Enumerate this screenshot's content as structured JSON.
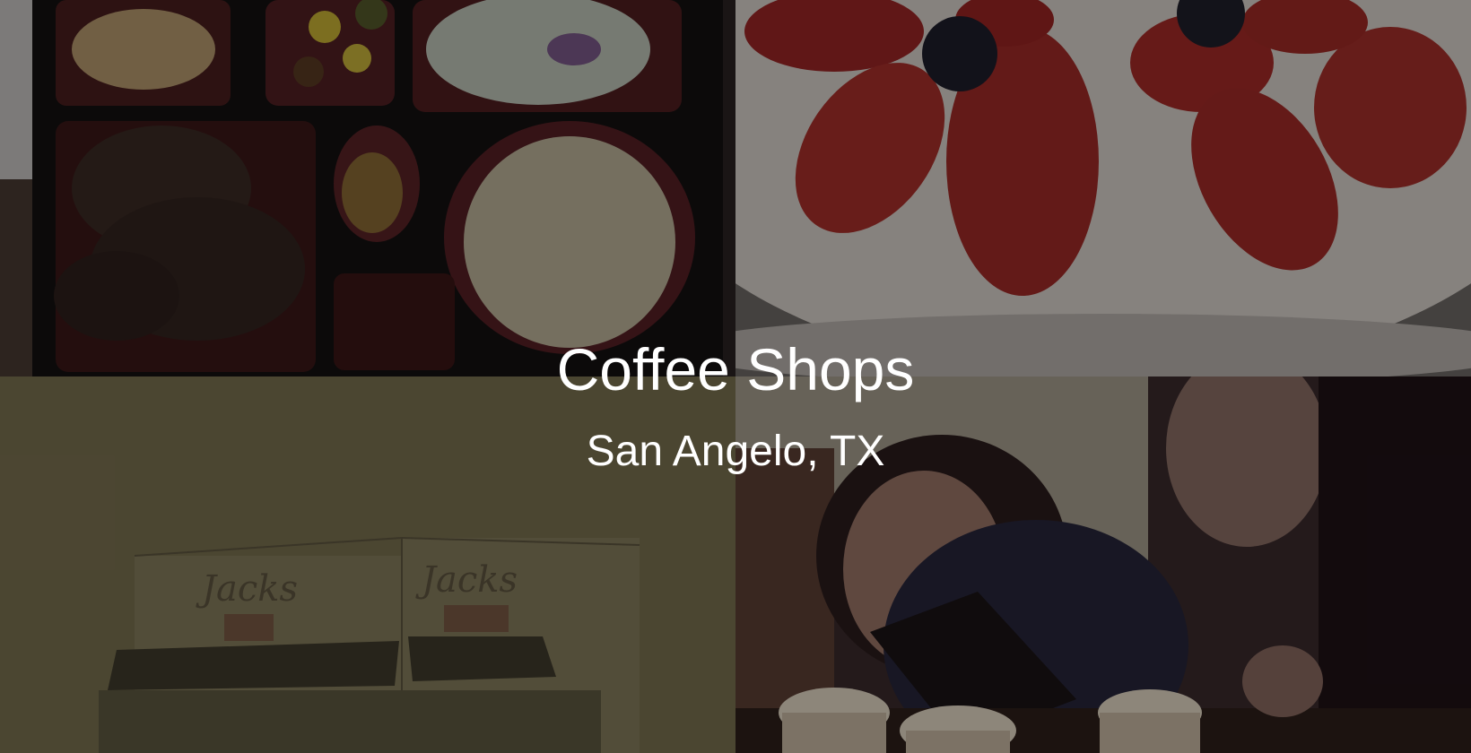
{
  "hero": {
    "title": "Coffee Shops",
    "subtitle": "San Angelo, TX"
  },
  "photos": [
    {
      "subject": "bento-box-photo"
    },
    {
      "subject": "strawberry-cake-photo"
    },
    {
      "subject": "cafe-storefront-sketch-photo"
    },
    {
      "subject": "friends-with-coffee-photo"
    }
  ],
  "colors": {
    "text": "#ffffff",
    "overlay": "rgba(0,0,0,0.38)",
    "storefront_tint": "#7a7150"
  }
}
